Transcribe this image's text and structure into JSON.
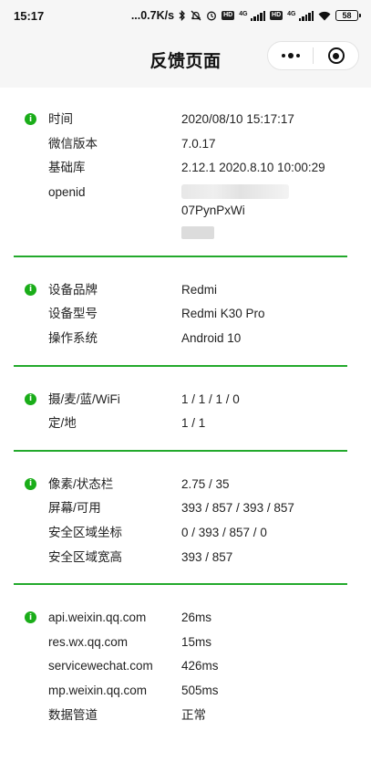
{
  "status_bar": {
    "time": "15:17",
    "speed": "...0.7K/s",
    "network_1": "4G",
    "network_2": "4G",
    "battery": "58"
  },
  "nav": {
    "title": "反馈页面"
  },
  "sections": [
    {
      "rows": [
        {
          "label": "时间",
          "value": "2020/08/10 15:17:17"
        },
        {
          "label": "微信版本",
          "value": "7.0.17"
        },
        {
          "label": "基础库",
          "value": "2.12.1 2020.8.10 10:00:29"
        },
        {
          "label": "openid",
          "value": "07PynPxWi"
        }
      ]
    },
    {
      "rows": [
        {
          "label": "设备品牌",
          "value": "Redmi"
        },
        {
          "label": "设备型号",
          "value": "Redmi K30 Pro"
        },
        {
          "label": "操作系统",
          "value": "Android 10"
        }
      ]
    },
    {
      "rows": [
        {
          "label": "摄/麦/蓝/WiFi",
          "value": "1 / 1 / 1 / 0"
        },
        {
          "label": "定/地",
          "value": "1 / 1"
        }
      ]
    },
    {
      "rows": [
        {
          "label": "像素/状态栏",
          "value": "2.75 / 35"
        },
        {
          "label": "屏幕/可用",
          "value": "393 / 857 / 393 / 857"
        },
        {
          "label": "安全区域坐标",
          "value": "0 / 393 / 857 / 0"
        },
        {
          "label": "安全区域宽高",
          "value": "393 / 857"
        }
      ]
    },
    {
      "rows": [
        {
          "label": "api.weixin.qq.com",
          "value": "26ms"
        },
        {
          "label": "res.wx.qq.com",
          "value": "15ms"
        },
        {
          "label": "servicewechat.com",
          "value": "426ms"
        },
        {
          "label": "mp.weixin.qq.com",
          "value": "505ms"
        },
        {
          "label": "数据管道",
          "value": "正常"
        }
      ]
    }
  ],
  "icons": {
    "info": "i",
    "info_color": "#1aad19",
    "divider_color": "#23a92c"
  }
}
